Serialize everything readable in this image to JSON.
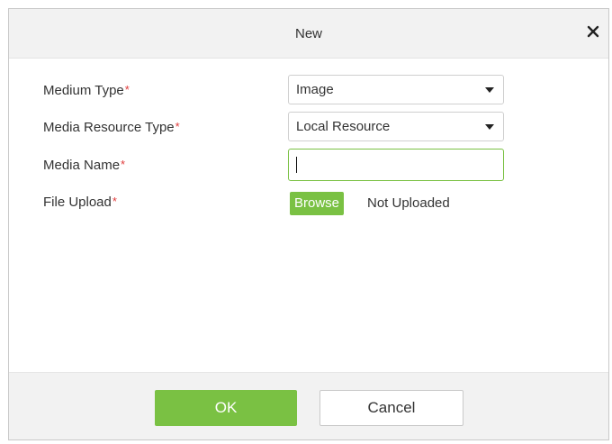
{
  "dialog": {
    "title": "New",
    "close_icon": "close-icon"
  },
  "form": {
    "medium_type": {
      "label": "Medium Type",
      "required_mark": "*",
      "value": "Image"
    },
    "media_resource_type": {
      "label": "Media Resource Type",
      "required_mark": "*",
      "value": "Local Resource"
    },
    "media_name": {
      "label": "Media Name",
      "required_mark": "*",
      "value": ""
    },
    "file_upload": {
      "label": "File Upload",
      "required_mark": "*",
      "browse_label": "Browse",
      "status": "Not Uploaded"
    }
  },
  "footer": {
    "ok_label": "OK",
    "cancel_label": "Cancel"
  },
  "colors": {
    "accent_green": "#7ac143",
    "required_red": "#e03b3b",
    "header_bg": "#f2f2f2"
  }
}
